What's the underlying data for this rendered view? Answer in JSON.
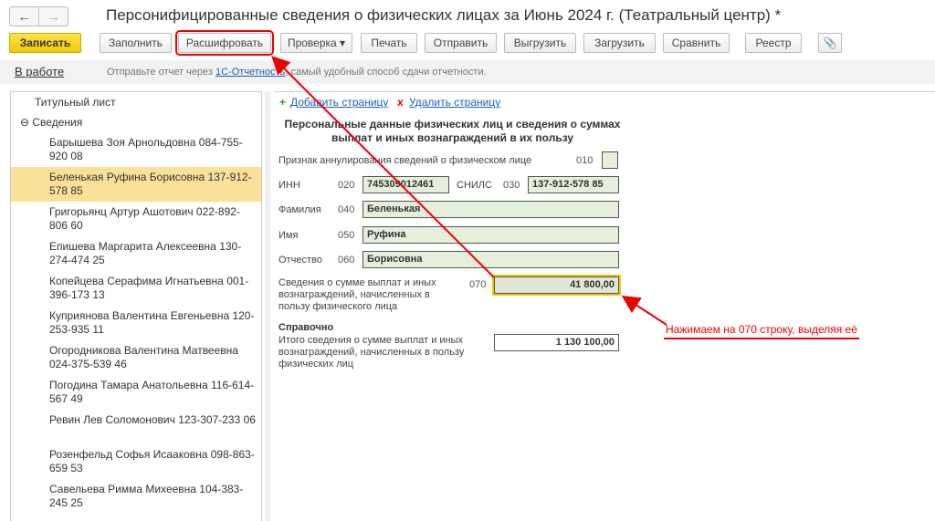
{
  "window": {
    "title": "Персонифицированные сведения о физических лицах за Июнь 2024 г. (Театральный центр) *",
    "back": "←",
    "forward": "→"
  },
  "toolbar": {
    "save": "Записать",
    "fill": "Заполнить",
    "decode": "Расшифровать",
    "check": "Проверка ▾",
    "print": "Печать",
    "send": "Отправить",
    "export": "Выгрузить",
    "import": "Загрузить",
    "compare": "Сравнить",
    "registry": "Реестр",
    "attach": "📎"
  },
  "info": {
    "status": "В работе",
    "msg_before": "Отправьте отчет через ",
    "link": "1С-Отчетность",
    "msg_after": ", самый удобный способ сдачи отчетности."
  },
  "sidebar": {
    "title_page": "Титульный лист",
    "group": "⊖ Сведения",
    "items": [
      "Барышева Зоя Арнольдовна 084-755-920 08",
      "Беленькая Руфина Борисовна 137-912-578 85",
      "Григорьянц Артур Ашотович 022-892-806 60",
      "Епишева Маргарита Алексеевна 130-274-474 25",
      "Копейцева Серафима Игнатьевна 001-396-173 13",
      "Куприянова Валентина Евгеньевна 120-253-935 11",
      "Огородникова Валентина Матвеевна 024-375-539 46",
      "Погодина Тамара Анатольевна 116-614-567 49",
      "Ревин Лев Соломонович 123-307-233 06",
      "Розенфельд Софья Исааковна 098-863-659 53",
      "Савельева Римма Михеевна 104-383-245 25"
    ]
  },
  "form": {
    "add_page": "Добавить страницу",
    "delete_page": "Удалить страницу",
    "add_icon": "+",
    "delete_icon": "x",
    "heading": "Персональные данные физических лиц и сведения о суммах выплат и иных вознаграждений в их пользу",
    "cancel_label": "Признак аннулирования сведений о физическом лице",
    "cancel_code": "010",
    "inn_label": "ИНН",
    "inn_code": "020",
    "inn": "745309012461",
    "snils_label": "СНИЛС",
    "snils_code": "030",
    "snils": "137-912-578 85",
    "surname_label": "Фамилия",
    "surname_code": "040",
    "surname": "Беленькая",
    "name_label": "Имя",
    "name_code": "050",
    "name": "Руфина",
    "patronymic_label": "Отчество",
    "patronymic_code": "060",
    "patronymic": "Борисовна",
    "sum_label": "Сведения о сумме выплат и иных вознаграждений, начисленных в пользу физического лица",
    "sum_code": "070",
    "sum": "41 800,00",
    "ref_heading": "Справочно",
    "total_label": "Итого сведения о сумме выплат и иных вознаграждений, начисленных в пользу физических лиц",
    "total": "1 130 100,00"
  },
  "annotation": "Нажимаем на 070 строку, выделяя её",
  "colors": {
    "accent": "#e00000",
    "save": "#f2c800",
    "selected": "#fbe09a",
    "field": "#e6efdc"
  }
}
